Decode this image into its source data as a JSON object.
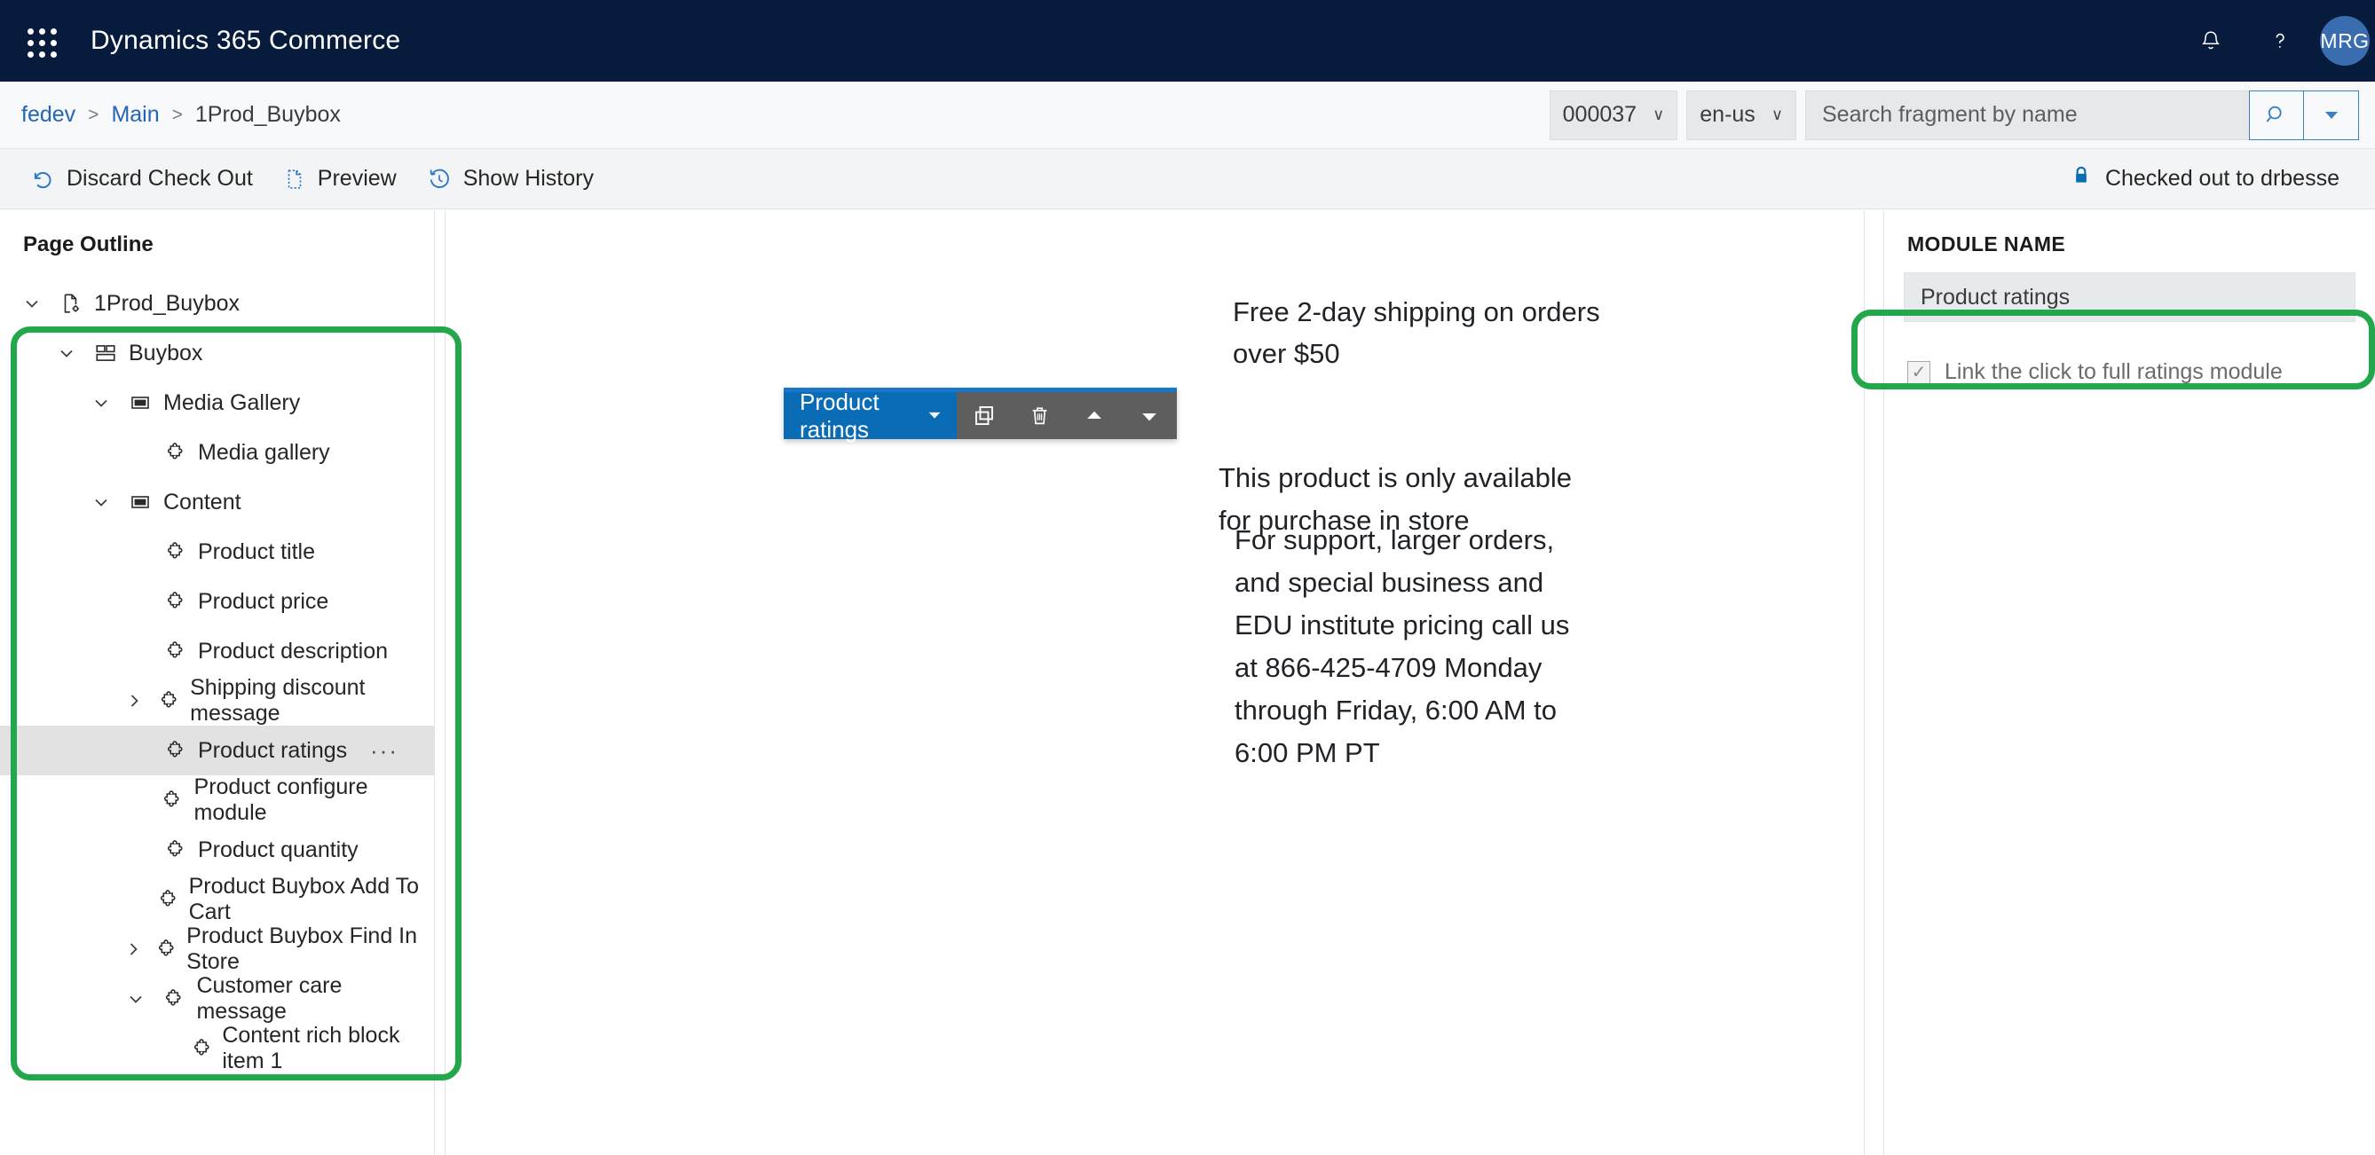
{
  "appbar": {
    "title": "Dynamics 365 Commerce",
    "waffle_icon": "app-launcher-icon",
    "notifications_icon": "bell-icon",
    "help_icon": "question-mark-icon",
    "avatar_initials": "MRG"
  },
  "breadcrumb": {
    "items": [
      {
        "label": "fedev",
        "link": true
      },
      {
        "label": "Main",
        "link": true
      },
      {
        "label": "1Prod_Buybox",
        "link": false
      }
    ],
    "separator": ">"
  },
  "header_controls": {
    "version_value": "000037",
    "locale_value": "en-us",
    "search_placeholder": "Search fragment by name",
    "search_value": "",
    "search_icon": "magnifier-icon",
    "search_dropdown_icon": "caret-down-icon"
  },
  "commandbar": {
    "items": [
      {
        "label": "Discard Check Out",
        "icon": "undo-icon"
      },
      {
        "label": "Preview",
        "icon": "page-preview-icon"
      },
      {
        "label": "Show History",
        "icon": "history-clock-icon"
      }
    ],
    "status": {
      "label": "Checked out to drbesse",
      "icon": "lock-icon"
    }
  },
  "outline": {
    "title": "Page Outline",
    "nodes": [
      {
        "label": "1Prod_Buybox",
        "indent": 0,
        "twisty": "expanded",
        "icon": "page-settings-icon",
        "selected": false,
        "dots": false
      },
      {
        "label": "Buybox",
        "indent": 1,
        "twisty": "expanded",
        "icon": "layout-grid-icon",
        "selected": false,
        "dots": false
      },
      {
        "label": "Media Gallery",
        "indent": 2,
        "twisty": "expanded",
        "icon": "container-icon",
        "selected": false,
        "dots": false
      },
      {
        "label": "Media gallery",
        "indent": 3,
        "twisty": "none",
        "icon": "module-puzzle-icon",
        "selected": false,
        "dots": false
      },
      {
        "label": "Content",
        "indent": 2,
        "twisty": "expanded",
        "icon": "container-icon",
        "selected": false,
        "dots": false
      },
      {
        "label": "Product title",
        "indent": 3,
        "twisty": "none",
        "icon": "module-puzzle-icon",
        "selected": false,
        "dots": false
      },
      {
        "label": "Product price",
        "indent": 3,
        "twisty": "none",
        "icon": "module-puzzle-icon",
        "selected": false,
        "dots": false
      },
      {
        "label": "Product description",
        "indent": 3,
        "twisty": "none",
        "icon": "module-puzzle-icon",
        "selected": false,
        "dots": false
      },
      {
        "label": "Shipping discount message",
        "indent": 3,
        "twisty": "collapsed",
        "icon": "module-puzzle-icon",
        "selected": false,
        "dots": false
      },
      {
        "label": "Product ratings",
        "indent": 3,
        "twisty": "none",
        "icon": "module-puzzle-icon",
        "selected": true,
        "dots": true
      },
      {
        "label": "Product configure module",
        "indent": 3,
        "twisty": "none",
        "icon": "module-puzzle-icon",
        "selected": false,
        "dots": false
      },
      {
        "label": "Product quantity",
        "indent": 3,
        "twisty": "none",
        "icon": "module-puzzle-icon",
        "selected": false,
        "dots": false
      },
      {
        "label": "Product Buybox Add To Cart",
        "indent": 3,
        "twisty": "none",
        "icon": "module-puzzle-icon",
        "selected": false,
        "dots": false
      },
      {
        "label": "Product Buybox Find In Store",
        "indent": 3,
        "twisty": "collapsed",
        "icon": "module-puzzle-icon",
        "selected": false,
        "dots": false
      },
      {
        "label": "Customer care message",
        "indent": 3,
        "twisty": "expanded",
        "icon": "module-puzzle-icon",
        "selected": false,
        "dots": false
      },
      {
        "label": "Content rich block item 1",
        "indent": 4,
        "twisty": "none",
        "icon": "module-puzzle-icon",
        "selected": false,
        "dots": false
      }
    ],
    "overflow_dots": "···"
  },
  "canvas": {
    "shipping_message": "Free 2-day shipping on orders over $50",
    "module_toolbar": {
      "module_label": "Product ratings",
      "caret_icon": "caret-down-icon",
      "buttons": [
        {
          "icon": "copy-icon",
          "name": "duplicate-module-button"
        },
        {
          "icon": "trash-icon",
          "name": "delete-module-button"
        },
        {
          "icon": "arrow-up-icon",
          "name": "move-up-button"
        },
        {
          "icon": "arrow-down-icon",
          "name": "move-down-button"
        }
      ]
    },
    "store_message": "This product is only available for purchase in store",
    "care_message": "For support, larger orders, and special business and EDU institute pricing call us at 866-425-4709 Monday through Friday, 6:00 AM to 6:00 PM PT"
  },
  "properties": {
    "section_label": "MODULE NAME",
    "module_name_value": "Product ratings",
    "checkbox": {
      "label": "Link the click to full ratings module",
      "checked": true,
      "check_glyph": "✓"
    }
  },
  "annotations": {
    "accent_color": "#22a74b",
    "tree_box_name": "outline-highlight",
    "checkbox_box_name": "checkbox-highlight"
  }
}
